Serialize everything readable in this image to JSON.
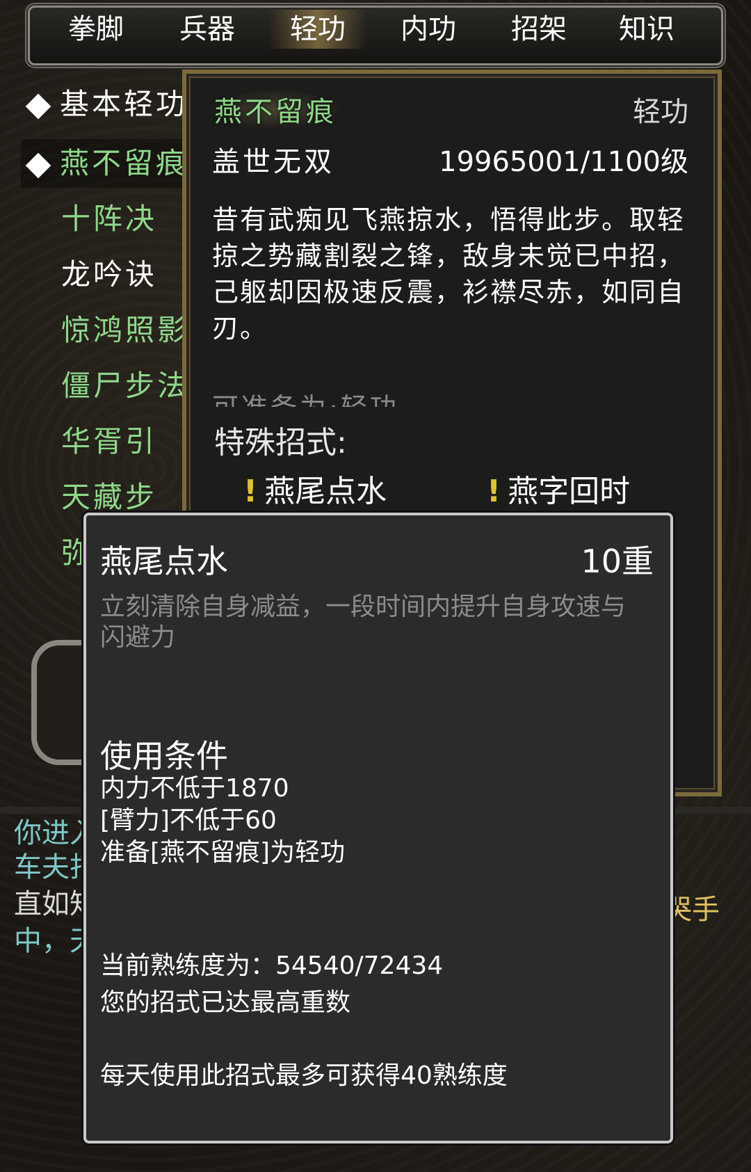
{
  "tabs": [
    "拳脚",
    "兵器",
    "轻功",
    "内功",
    "招架",
    "知识"
  ],
  "active_tab": "轻功",
  "skill_list": [
    {
      "label": "基本轻功",
      "color": "white",
      "marked": true
    },
    {
      "label": "燕不留痕",
      "color": "green",
      "marked": true,
      "selected": true
    },
    {
      "label": "十阵决",
      "color": "green"
    },
    {
      "label": "龙吟诀",
      "color": "white"
    },
    {
      "label": "惊鸿照影",
      "color": "green"
    },
    {
      "label": "僵尸步法",
      "color": "green"
    },
    {
      "label": "华胥引",
      "color": "green"
    },
    {
      "label": "天藏步",
      "color": "green"
    },
    {
      "label": "弥",
      "color": "green"
    }
  ],
  "detail": {
    "name": "燕不留痕",
    "type": "轻功",
    "rank": "盖世无双",
    "level": "19965001/1100级",
    "description": "昔有武痴见飞燕掠水，悟得此步。取轻掠之势藏割裂之锋，敌身未觉已中招，己躯却因极速反震，衫襟尽赤，如同自刃。",
    "faded_line": "可准备为:轻功",
    "special_label": "特殊招式:",
    "special_skills": [
      "燕尾点水",
      "燕字回时"
    ]
  },
  "popup": {
    "title": "燕尾点水",
    "level": "10重",
    "description": "立刻清除自身减益，一段时间内提升自身攻速与闪避力",
    "conditions_heading": "使用条件",
    "conditions": [
      "内力不低于1870",
      "[臂力]不低于60",
      "准备[燕不留痕]为轻功"
    ],
    "proficiency": "当前熟练度为：54540/72434",
    "max_note": "您的招式已达最高重数",
    "daily_note": "每天使用此招式最多可获得40熟练度"
  },
  "log": {
    "line1": "你进入",
    "line2": "车夫打",
    "line3": "直如知",
    "line3_right": "哭手",
    "line4": "中，天"
  },
  "colors": {
    "green_text": "#8fd88a",
    "gold_border": "#7c6a3c",
    "popup_bg": "#2b2b2b",
    "excl": "#e0c230"
  }
}
